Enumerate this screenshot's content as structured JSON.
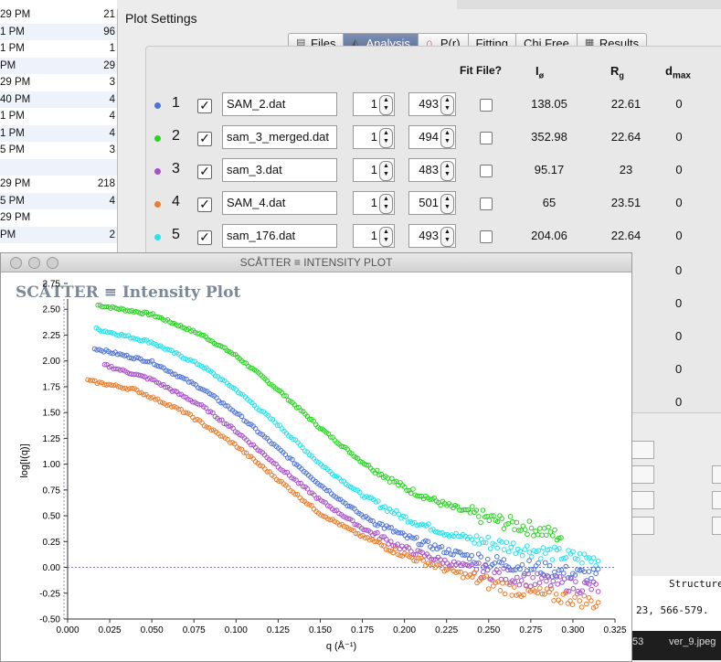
{
  "background_left": {
    "rows": [
      {
        "time": "29 PM",
        "num": "21"
      },
      {
        "time": "1 PM",
        "num": "96"
      },
      {
        "time": "1 PM",
        "num": "1"
      },
      {
        "time": "PM",
        "num": "29"
      },
      {
        "time": "29 PM",
        "num": "3"
      },
      {
        "time": "40 PM",
        "num": "4"
      },
      {
        "time": "1 PM",
        "num": "4"
      },
      {
        "time": "1 PM",
        "num": "4"
      },
      {
        "time": "5 PM",
        "num": "3"
      },
      {
        "time": "",
        "num": ""
      },
      {
        "time": "29 PM",
        "num": "218"
      },
      {
        "time": "5 PM",
        "num": "4"
      },
      {
        "time": "29 PM",
        "num": ""
      },
      {
        "time": "PM",
        "num": "2"
      }
    ]
  },
  "background_right": {
    "line1": "Structure",
    "line2": "23, 566-579.",
    "taskbar_num": "53",
    "taskbar_file": "ver_9.jpeg"
  },
  "plot_settings": {
    "title": "Plot Settings",
    "tabs": [
      {
        "label": "Files",
        "icon": "files-icon",
        "active": false
      },
      {
        "label": "Analysis",
        "icon": "analysis-icon",
        "active": true
      },
      {
        "label": "P(r)",
        "icon": "pr-icon",
        "active": false
      },
      {
        "label": "Fitting",
        "icon": "",
        "active": false
      },
      {
        "label": "Chi Free",
        "icon": "",
        "active": false
      },
      {
        "label": "Results",
        "icon": "results-icon",
        "active": false
      }
    ],
    "headers": {
      "fit_file": "Fit File?",
      "i0": "I",
      "i0_sub": "ø",
      "rg": "R",
      "rg_sub": "g",
      "dmax": "d",
      "dmax_sub": "max"
    },
    "rows": [
      {
        "index": "1",
        "color": "#4e73d8",
        "file": "SAM_2.dat",
        "start": "1",
        "end": "493",
        "i0": "138.05",
        "rg": "22.61",
        "dmax": "0"
      },
      {
        "index": "2",
        "color": "#27d61f",
        "file": "sam_3_merged.dat",
        "start": "1",
        "end": "494",
        "i0": "352.98",
        "rg": "22.64",
        "dmax": "0"
      },
      {
        "index": "3",
        "color": "#a74fcc",
        "file": "sam_3.dat",
        "start": "1",
        "end": "483",
        "i0": "95.17",
        "rg": "23",
        "dmax": "0"
      },
      {
        "index": "4",
        "color": "#ee7b2a",
        "file": "SAM_4.dat",
        "start": "1",
        "end": "501",
        "i0": "65",
        "rg": "23.51",
        "dmax": "0"
      },
      {
        "index": "5",
        "color": "#22e4ee",
        "file": "sam_176.dat",
        "start": "1",
        "end": "493",
        "i0": "204.06",
        "rg": "22.64",
        "dmax": "0"
      }
    ],
    "extra_dmax": [
      "0",
      "0",
      "0",
      "0",
      "0"
    ]
  },
  "intensity_window": {
    "window_title": "SCÅTTER ≡ INTENSITY PLOT",
    "plot_title": "SCÅTTER ≡ Intensity Plot"
  },
  "chart_data": {
    "type": "scatter",
    "xlabel": "q (Å⁻¹)",
    "ylabel": "log[I(q)]",
    "xlim": [
      0.0,
      0.325
    ],
    "ylim": [
      -0.5,
      2.75
    ],
    "xticks": [
      "0.000",
      "0.025",
      "0.050",
      "0.075",
      "0.100",
      "0.125",
      "0.150",
      "0.175",
      "0.200",
      "0.225",
      "0.250",
      "0.275",
      "0.300",
      "0.325"
    ],
    "yticks": [
      "-0.50",
      "-0.25",
      "0.00",
      "0.25",
      "0.50",
      "0.75",
      "1.00",
      "1.25",
      "1.50",
      "1.75",
      "2.00",
      "2.25",
      "2.50",
      "2.75"
    ],
    "series": [
      {
        "color": "#27d61f",
        "points": [
          [
            0.018,
            2.54
          ],
          [
            0.05,
            2.45
          ],
          [
            0.08,
            2.25
          ],
          [
            0.1,
            2.05
          ],
          [
            0.125,
            1.72
          ],
          [
            0.15,
            1.35
          ],
          [
            0.175,
            1.02
          ],
          [
            0.2,
            0.77
          ],
          [
            0.225,
            0.6
          ],
          [
            0.25,
            0.47
          ],
          [
            0.275,
            0.38
          ],
          [
            0.293,
            0.3
          ]
        ]
      },
      {
        "color": "#22e4ee",
        "points": [
          [
            0.017,
            2.31
          ],
          [
            0.05,
            2.18
          ],
          [
            0.08,
            1.95
          ],
          [
            0.1,
            1.72
          ],
          [
            0.125,
            1.38
          ],
          [
            0.15,
            1.0
          ],
          [
            0.175,
            0.7
          ],
          [
            0.2,
            0.48
          ],
          [
            0.225,
            0.33
          ],
          [
            0.25,
            0.24
          ],
          [
            0.275,
            0.17
          ],
          [
            0.3,
            0.1
          ],
          [
            0.315,
            0.07
          ]
        ]
      },
      {
        "color": "#4e73d8",
        "points": [
          [
            0.016,
            2.12
          ],
          [
            0.05,
            1.99
          ],
          [
            0.08,
            1.73
          ],
          [
            0.1,
            1.5
          ],
          [
            0.125,
            1.15
          ],
          [
            0.15,
            0.8
          ],
          [
            0.175,
            0.5
          ],
          [
            0.2,
            0.3
          ],
          [
            0.225,
            0.16
          ],
          [
            0.25,
            0.06
          ],
          [
            0.275,
            0.0
          ],
          [
            0.3,
            -0.06
          ],
          [
            0.315,
            -0.08
          ]
        ]
      },
      {
        "color": "#a74fcc",
        "points": [
          [
            0.022,
            1.96
          ],
          [
            0.05,
            1.82
          ],
          [
            0.08,
            1.56
          ],
          [
            0.1,
            1.32
          ],
          [
            0.125,
            0.98
          ],
          [
            0.15,
            0.65
          ],
          [
            0.175,
            0.38
          ],
          [
            0.2,
            0.18
          ],
          [
            0.225,
            0.05
          ],
          [
            0.25,
            -0.05
          ],
          [
            0.275,
            -0.12
          ],
          [
            0.3,
            -0.17
          ],
          [
            0.315,
            -0.2
          ]
        ]
      },
      {
        "color": "#ee7b2a",
        "points": [
          [
            0.012,
            1.81
          ],
          [
            0.04,
            1.72
          ],
          [
            0.07,
            1.5
          ],
          [
            0.1,
            1.18
          ],
          [
            0.125,
            0.85
          ],
          [
            0.15,
            0.52
          ],
          [
            0.175,
            0.3
          ],
          [
            0.2,
            0.12
          ],
          [
            0.225,
            -0.02
          ],
          [
            0.25,
            -0.15
          ],
          [
            0.275,
            -0.25
          ],
          [
            0.3,
            -0.3
          ],
          [
            0.315,
            -0.35
          ]
        ]
      }
    ]
  }
}
